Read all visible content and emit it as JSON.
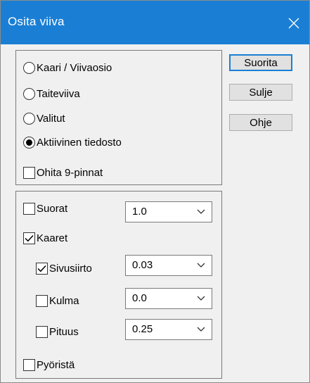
{
  "window": {
    "title": "Osita viiva",
    "close_glyph": "close-icon",
    "titlebar_color": "#1a7fd4"
  },
  "mode_options": [
    {
      "label": "Kaari / Viivaosio",
      "selected": false
    },
    {
      "label": "Taiteviiva",
      "selected": false
    },
    {
      "label": "Valitut",
      "selected": false
    },
    {
      "label": "Aktiivinen tiedosto",
      "selected": true
    }
  ],
  "skip_checkbox": {
    "label": "Ohita 9-pinnat",
    "checked": false
  },
  "segments": {
    "suorat": {
      "label": "Suorat",
      "checked": false,
      "value": "1.0"
    },
    "kaaret": {
      "label": "Kaaret",
      "checked": true
    },
    "sivusiirto": {
      "label": "Sivusiirto",
      "checked": true,
      "value": "0.03"
    },
    "kulma": {
      "label": "Kulma",
      "checked": false,
      "value": "0.0"
    },
    "pituus": {
      "label": "Pituus",
      "checked": false,
      "value": "0.25"
    },
    "pyorista": {
      "label": "Pyöristä",
      "checked": false
    }
  },
  "buttons": {
    "run": "Suorita",
    "close": "Sulje",
    "help": "Ohje"
  }
}
